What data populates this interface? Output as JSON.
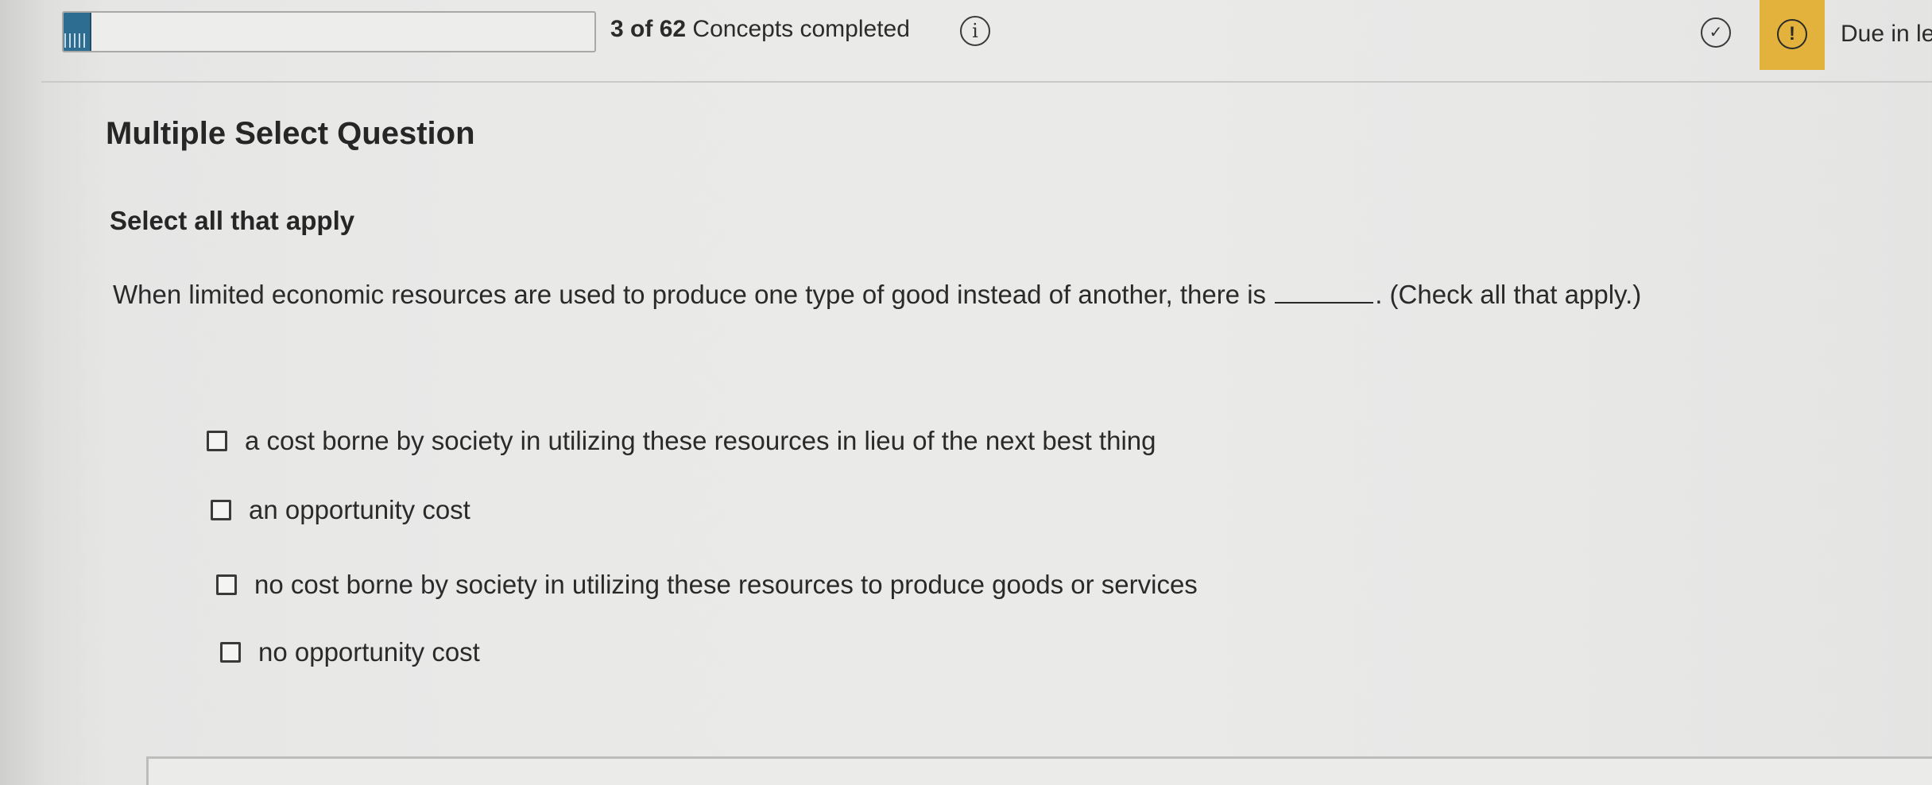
{
  "header": {
    "progress_fraction": 0.05,
    "progress_completed": "3",
    "progress_total": "62",
    "progress_suffix": "Concepts completed",
    "info_icon_glyph": "i",
    "check_icon_glyph": "✓",
    "due_icon_glyph": "!",
    "due_text": "Due in le",
    "colors": {
      "progress_fill": "#2d6d92",
      "due_badge": "#e3b23c"
    }
  },
  "question": {
    "type_label": "Multiple Select Question",
    "instruction": "Select all that apply",
    "prompt_before": "When limited economic resources are used to produce one type of good instead of another, there is",
    "prompt_after": ". (Check all that apply.)",
    "options": [
      {
        "label": "a cost borne by society in utilizing these resources in lieu of the next best thing",
        "checked": false
      },
      {
        "label": "an opportunity cost",
        "checked": false
      },
      {
        "label": "no cost borne by society in utilizing these resources to produce goods or services",
        "checked": false
      },
      {
        "label": "no opportunity cost",
        "checked": false
      }
    ]
  }
}
